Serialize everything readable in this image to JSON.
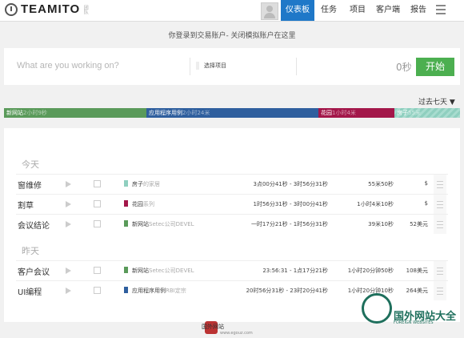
{
  "header": {
    "logo_text": "TEAMITO",
    "logo_sub": "团队",
    "nav": [
      {
        "label": "仪表板",
        "active": true
      },
      {
        "label": "任务",
        "active": false
      },
      {
        "label": "项目",
        "active": false
      },
      {
        "label": "客户端",
        "active": false
      },
      {
        "label": "报告",
        "active": false
      }
    ]
  },
  "notice": "你登录到交易账户- 关闭模拟账户在这里",
  "timer": {
    "placeholder": "What are you working on?",
    "project_select": "选择项目",
    "duration": "0秒",
    "start_label": "开始"
  },
  "range_label": "过去七天 ▼",
  "summary_bars": [
    {
      "label": "新网站",
      "time": "2小时9秒",
      "color": "#5a9a5a"
    },
    {
      "label": "应用程序用例",
      "time": "2小时24米",
      "color": "#2f5f9e"
    },
    {
      "label": "花园",
      "time": "1小时4米",
      "color": "#a3174a"
    },
    {
      "label": "房子",
      "time": "55米",
      "color": "#8fcfbf"
    }
  ],
  "sections": [
    {
      "day": "今天",
      "rows": [
        {
          "name": "窗维修",
          "project": "房子",
          "client": "的家居",
          "color": "#8fcfbf",
          "span": "3点00分41秒 - 3时56分31秒",
          "duration": "55米50秒",
          "amount": "$"
        },
        {
          "name": "割草",
          "project": "花园",
          "client": "系列",
          "color": "#a3174a",
          "span": "1时56分31秒 - 3时00分41秒",
          "duration": "1小时4米10秒",
          "amount": "$"
        },
        {
          "name": "会议结论",
          "project": "新网站",
          "client": "Setec公司DEVEL",
          "color": "#5a9a5a",
          "span": "一时17分21秒 - 1时56分31秒",
          "duration": "39米10秒",
          "amount": "52美元"
        }
      ]
    },
    {
      "day": "昨天",
      "rows": [
        {
          "name": "客户会议",
          "project": "新网站",
          "client": "Setec公司DEVEL",
          "color": "#5a9a5a",
          "span": "23:56:31 - 1点17分21秒",
          "duration": "1小时20分钟50秒",
          "amount": "108美元"
        },
        {
          "name": "UI编程",
          "project": "应用程序用例",
          "client": "RBI定宗",
          "color": "#2f5f9e",
          "span": "20时56分31秒 - 23时20分41秒",
          "duration": "1小时20分钟10秒",
          "amount": "264美元"
        }
      ]
    }
  ],
  "watermark": {
    "main": "国外网站大全",
    "sub": "FOREIGN WEBSITES",
    "small": "国外网站",
    "url": "www.egouz.com"
  }
}
